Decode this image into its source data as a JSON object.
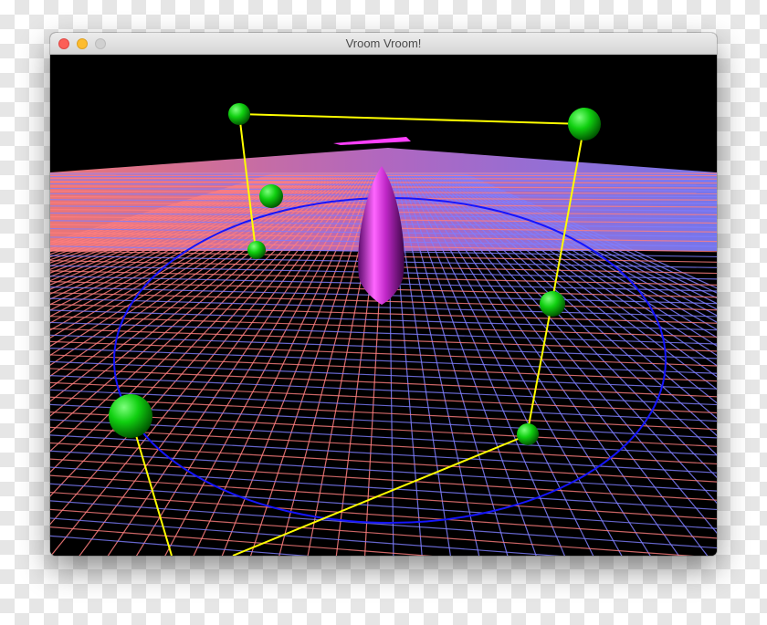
{
  "window": {
    "title": "Vroom Vroom!"
  },
  "controls": {
    "close": "close-button",
    "minimize": "minimize-button",
    "zoom": "zoom-button"
  },
  "scene": {
    "background_color": "#000000",
    "floor_colors": {
      "near": "#ff7f7f",
      "far": "#7f7fff"
    },
    "track_color": "#0000ff",
    "path_color": "#ffff00",
    "marker_color": "#00cc00",
    "car_color": "#cc33cc"
  }
}
